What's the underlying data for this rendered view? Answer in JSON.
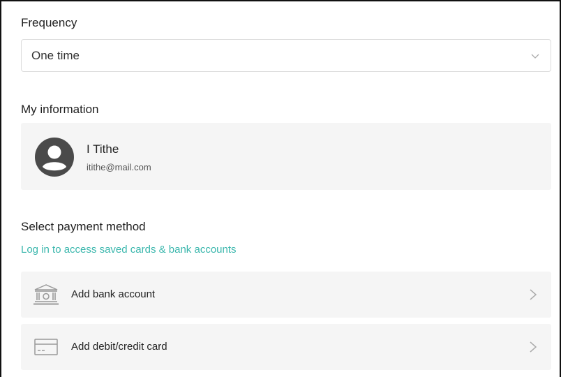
{
  "frequency": {
    "label": "Frequency",
    "selected": "One time"
  },
  "my_info": {
    "heading": "My information",
    "name": "I Tithe",
    "email": "itithe@mail.com"
  },
  "payment": {
    "heading": "Select payment method",
    "login_link": "Log in to access saved cards & bank accounts",
    "options": [
      {
        "label": "Add bank account",
        "icon": "bank-icon"
      },
      {
        "label": "Add debit/credit card",
        "icon": "credit-card-icon"
      }
    ]
  },
  "colors": {
    "link": "#3bb7ad",
    "card_bg": "#f5f5f5",
    "avatar": "#4a4a4a"
  }
}
